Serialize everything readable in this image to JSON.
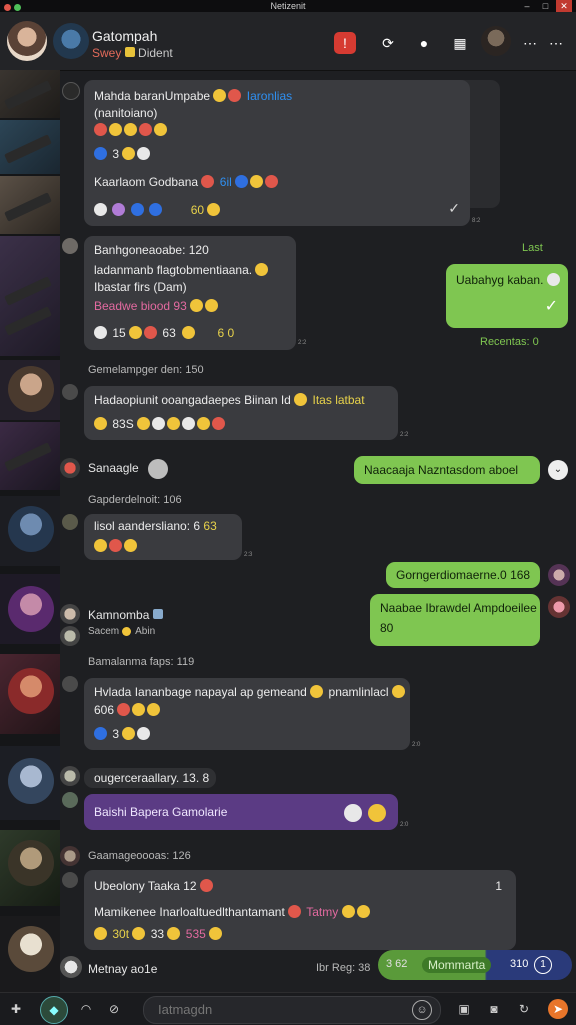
{
  "app": {
    "title": "Netizenit"
  },
  "header": {
    "title": "Gatompah",
    "subtitle_prefix": "Swey",
    "subtitle_name": "Dident"
  },
  "chat": {
    "msg1": {
      "line1": "Mahda baranUmpabe",
      "line1_link": "Iaronlias",
      "line2": "(nanitoiano)",
      "line3_count": "3",
      "line4": "Kaarlaom Godbana",
      "line4_tail": "6il",
      "reaction_count": "60",
      "time": "8:2"
    },
    "msg2": {
      "line1": "Banhgoneaoabe: 120",
      "line2": "ladanmanb flagtobmentiaana.",
      "line3": "Ibastar firs (Dam)",
      "line4": "Beadwe biood 93",
      "line5_a": "15",
      "line5_b": "63",
      "line5_c": "6 0",
      "time": "2:2"
    },
    "msg3": {
      "text": "Uabahyg kaban.",
      "time": "Last",
      "sub": "Recentas: 0"
    },
    "sys1": "Gemelampger den: 150",
    "msg4": {
      "line1": "Hadaopiunit ooangadaepes Biinan Id",
      "line1_tail": "Itas latbat",
      "line2": "83S",
      "time": "2:2"
    },
    "sender1": "Sanaagle",
    "msg5": {
      "text": "Naacaaja Nazntasdom aboel"
    },
    "sys2": "Gapderdelnoit: 106",
    "msg6": {
      "line1": "lisol aandersliano: 6",
      "line1_tail": "63",
      "time": "2:3"
    },
    "msg7": {
      "text": "Gorngerdiomaerne.0 168"
    },
    "msg8": {
      "line1": "Naabae Ibrawdel Ampdoeilee",
      "line2": "80"
    },
    "sender2": "Kamnomba",
    "sender2_sub": "Sacem",
    "sender2_tail": "Abin",
    "sys3": "Bamalanma faps: 119",
    "msg9": {
      "line1": "Hvlada Iananbage napayal ap gemeand",
      "line1_tail": "pnamlinlacl",
      "line2": "606",
      "line3_count": "3",
      "time": "2:0"
    },
    "msg10": {
      "text": "ougerceraallary. 13. 8"
    },
    "msg11": {
      "text": "Baishi Bapera Gamolarie",
      "time": "2:0"
    },
    "sys4": "Gaamageoooas: 126",
    "msg12": {
      "line1": "Ubeolony Taaka 12",
      "line1_tail": "1",
      "line3": "Mamikenee Inarloaltuedlthantamant",
      "line3_tail": "Tatmy",
      "line4_a": "30t",
      "line4_b": "33",
      "line4_c": "535"
    },
    "msg13": {
      "sender": "Metnay ao1e",
      "meta": "Ibr Reg: 38"
    },
    "pill": {
      "label": "Mommarta",
      "count": "310",
      "num": "1",
      "prefix": "3 62"
    }
  },
  "input": {
    "placeholder": "Iatmagdn"
  },
  "colors": {
    "green": "#7fc651",
    "purple": "#5b3b84",
    "bubble": "#3a3b3f",
    "bg": "#1e1f22"
  }
}
